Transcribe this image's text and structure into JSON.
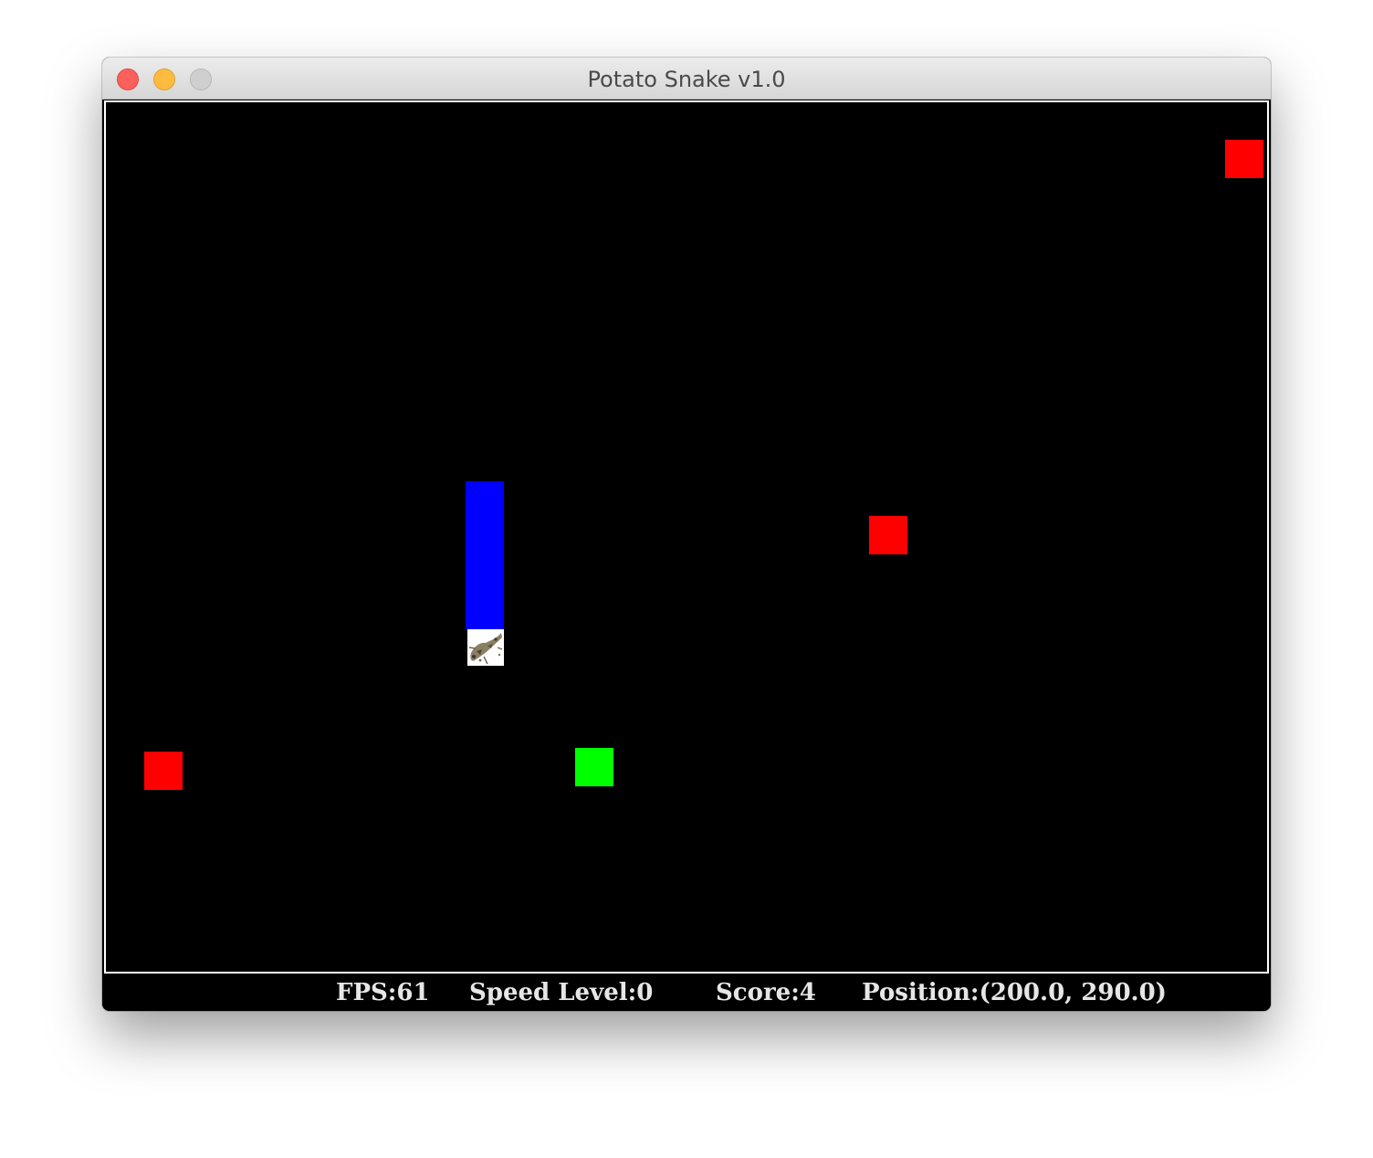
{
  "window": {
    "title": "Potato Snake v1.0"
  },
  "game": {
    "background": "#000000",
    "food_color": "#ff0000",
    "bonus_color": "#00ff00",
    "snake_color": "#0000ff"
  },
  "status": {
    "fps": "FPS:61",
    "speed": "Speed Level:0",
    "score": "Score:4",
    "position": "Position:(200.0, 290.0)"
  }
}
